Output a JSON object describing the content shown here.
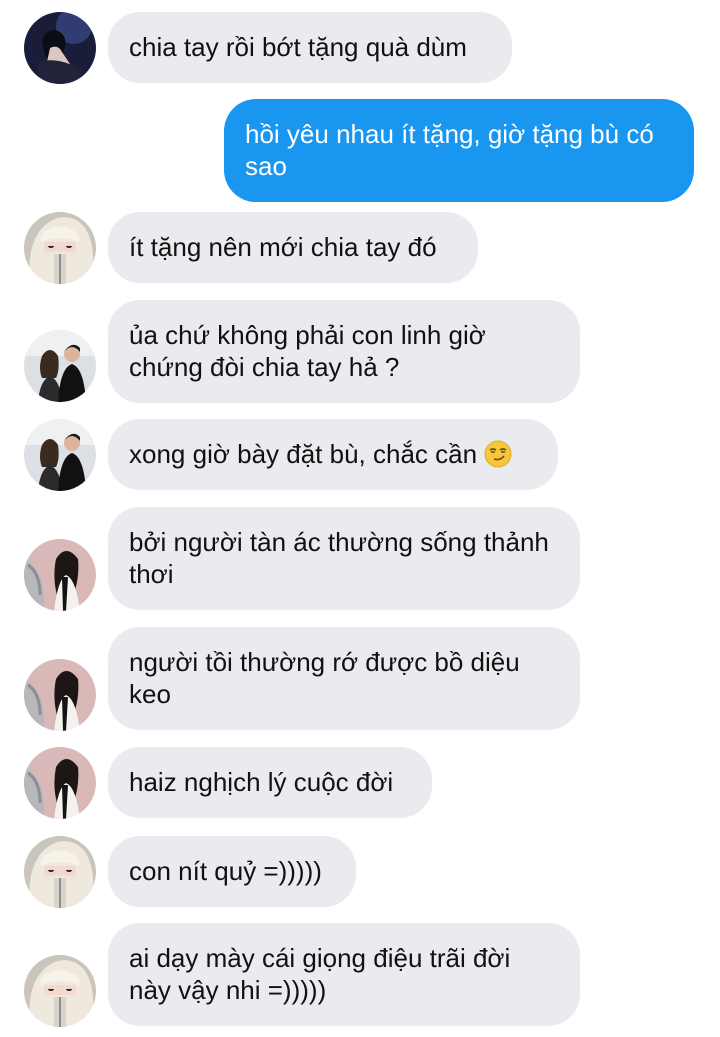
{
  "colors": {
    "incoming_bubble": "#e9ebee",
    "outgoing_bubble": "#1896f0",
    "incoming_text": "#111111",
    "outgoing_text": "#ffffff"
  },
  "messages": [
    {
      "direction": "incoming",
      "avatar": "avatar-girl-dark",
      "text": "chia tay rồi bớt tặng quà dùm"
    },
    {
      "direction": "outgoing",
      "text": "hồi yêu nhau ít tặng, giờ tặng bù có sao"
    },
    {
      "direction": "incoming",
      "avatar": "avatar-fur-hood",
      "text": "ít tặng nên mới chia tay đó"
    },
    {
      "direction": "incoming",
      "avatar": "avatar-couple",
      "text": "ủa chứ không phải con linh giờ chứng đòi chia tay hả ?"
    },
    {
      "direction": "incoming",
      "avatar": "avatar-couple",
      "text": "xong giờ bày đặt bù, chắc cần",
      "emoji": "smirking-face-emoji"
    },
    {
      "direction": "incoming",
      "avatar": "avatar-girl-pink",
      "text": "bởi người tàn ác thường sống thảnh thơi"
    },
    {
      "direction": "incoming",
      "avatar": "avatar-girl-pink",
      "text": "người tồi thường rớ được bồ diệu keo"
    },
    {
      "direction": "incoming",
      "avatar": "avatar-girl-pink",
      "text": "haiz nghịch lý cuộc đời"
    },
    {
      "direction": "incoming",
      "avatar": "avatar-fur-hood",
      "text": "con nít quỷ =)))))"
    },
    {
      "direction": "incoming",
      "avatar": "avatar-fur-hood",
      "text": "ai dạy mày cái giọng điệu trãi đời này vậy nhi =)))))"
    }
  ]
}
